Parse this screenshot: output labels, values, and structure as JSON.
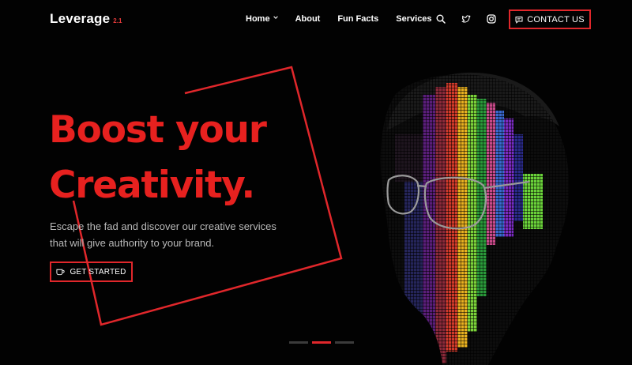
{
  "brand": {
    "name": "Leverage",
    "version": "2.1"
  },
  "nav": {
    "items": [
      {
        "label": "Home",
        "has_dropdown": true
      },
      {
        "label": "About"
      },
      {
        "label": "Fun Facts"
      },
      {
        "label": "Services"
      }
    ],
    "icons": [
      "search-icon",
      "twitter-icon",
      "instagram-icon"
    ],
    "contact_label": "CONTACT US",
    "contact_icon": "chat-icon"
  },
  "hero": {
    "headline_line1": "Boost your",
    "headline_line2": "Creativity.",
    "subtitle": "Escape the fad and discover our creative services that will give authority to your brand.",
    "cta_label": "GET STARTED",
    "cta_icon": "coffee-cup-icon"
  },
  "slider": {
    "count": 3,
    "active_index": 1
  },
  "colors": {
    "accent": "#e0272b",
    "background": "#020202",
    "text": "#ffffff",
    "muted": "#b9b9b9"
  }
}
